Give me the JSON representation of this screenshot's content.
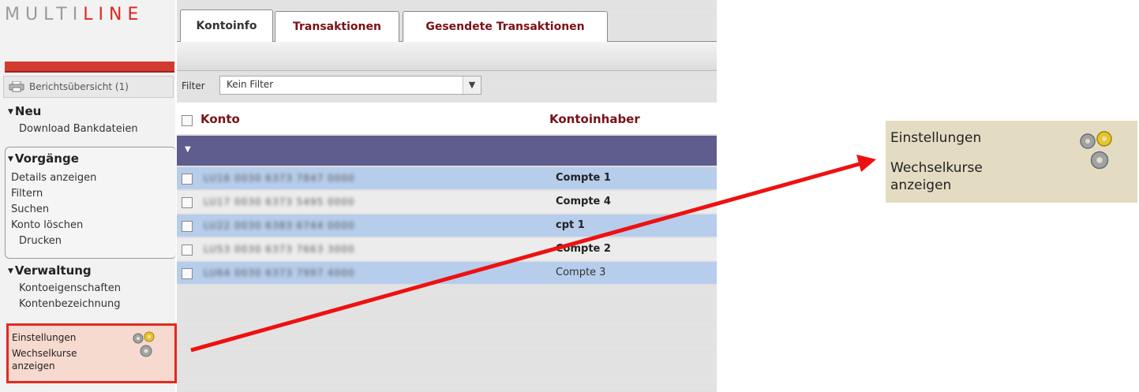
{
  "app": {
    "logo_main": "MULTI",
    "logo_accent": "LINE"
  },
  "sidebar": {
    "reports_label": "Berichtsübersicht (1)",
    "sections": [
      {
        "title": "Neu",
        "items": [
          "Download Bankdateien"
        ]
      },
      {
        "title": "Vorgänge",
        "items": [
          "Details anzeigen",
          "Filtern",
          "Suchen",
          "Konto löschen",
          "Drucken"
        ]
      },
      {
        "title": "Verwaltung",
        "items": [
          "Kontoeigenschaften",
          "Kontenbezeichnung"
        ]
      }
    ],
    "settings": {
      "items": [
        "Einstellungen",
        "Wechselkurse",
        "anzeigen"
      ]
    }
  },
  "tabs": [
    {
      "label": "Kontoinfo",
      "active": true
    },
    {
      "label": "Transaktionen",
      "active": false
    },
    {
      "label": "Gesendete Transaktionen",
      "active": false
    }
  ],
  "filter": {
    "label": "Filter",
    "value": "Kein Filter"
  },
  "table": {
    "columns": [
      "Konto",
      "Kontoinhaber"
    ],
    "rows": [
      {
        "account": "LU16 0030 6373 7847 0000",
        "holder": "Compte 1"
      },
      {
        "account": "LU17 0030 6373 5495 0000",
        "holder": "Compte 4"
      },
      {
        "account": "LU22 0030 6383 6744 0000",
        "holder": "cpt 1"
      },
      {
        "account": "LU53 0030 6373 7663 3000",
        "holder": "Compte 2"
      },
      {
        "account": "LU64 0030 6373 7997 4000",
        "holder": "Compte 3"
      }
    ]
  },
  "zoom": {
    "items": [
      "Einstellungen",
      "Wechselkurse",
      "anzeigen"
    ]
  },
  "colors": {
    "accent_red": "#e0251b",
    "tab_text": "#7a1018",
    "group_row": "#5f5c8e",
    "row_highlight": "#b6cdeb"
  }
}
